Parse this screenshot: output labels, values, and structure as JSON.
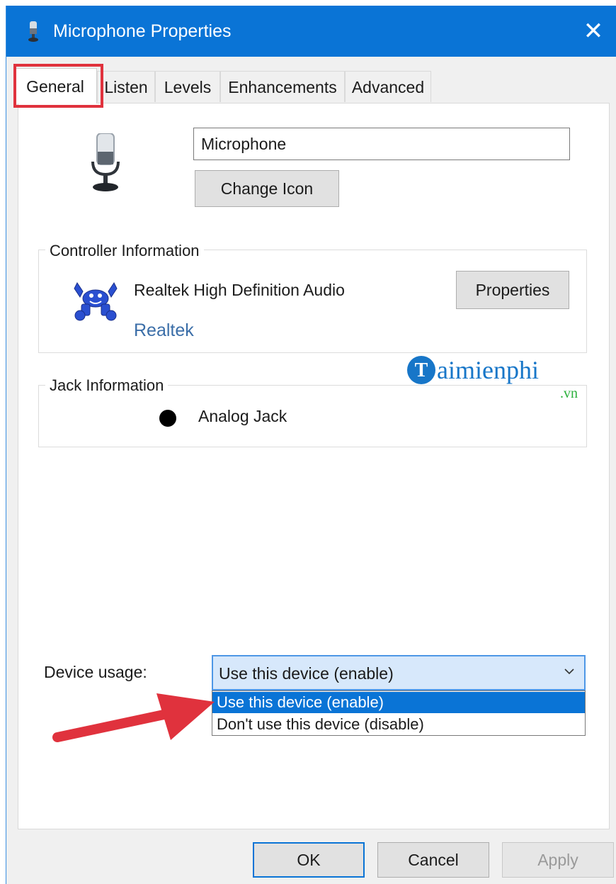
{
  "window": {
    "title": "Microphone Properties",
    "close_glyph": "✕",
    "title_icon": "microphone-icon",
    "titlebar_color": "#0a74d6"
  },
  "tabs": [
    {
      "label": "General",
      "active": true
    },
    {
      "label": "Listen",
      "active": false
    },
    {
      "label": "Levels",
      "active": false
    },
    {
      "label": "Enhancements",
      "active": false
    },
    {
      "label": "Advanced",
      "active": false
    }
  ],
  "general": {
    "device_name_value": "Microphone",
    "change_icon_label": "Change Icon",
    "device_icon": "microphone-icon"
  },
  "controller": {
    "group_label": "Controller Information",
    "device_name": "Realtek High Definition Audio",
    "vendor_link": "Realtek",
    "properties_label": "Properties",
    "logo": "realtek-crab-logo"
  },
  "jack": {
    "group_label": "Jack Information",
    "jack_text": "Analog Jack"
  },
  "watermark": {
    "text": "aimienphi",
    "suffix": ".vn"
  },
  "device_usage": {
    "label": "Device usage:",
    "selected": "Use this device (enable)",
    "options": [
      "Use this device (enable)",
      "Don't use this device (disable)"
    ],
    "highlight_color": "#0a74d6"
  },
  "annotations": {
    "tab_highlight_color": "#e0323d",
    "arrow_color": "#e0323d"
  },
  "footer": {
    "ok_label": "OK",
    "cancel_label": "Cancel",
    "apply_label": "Apply"
  }
}
